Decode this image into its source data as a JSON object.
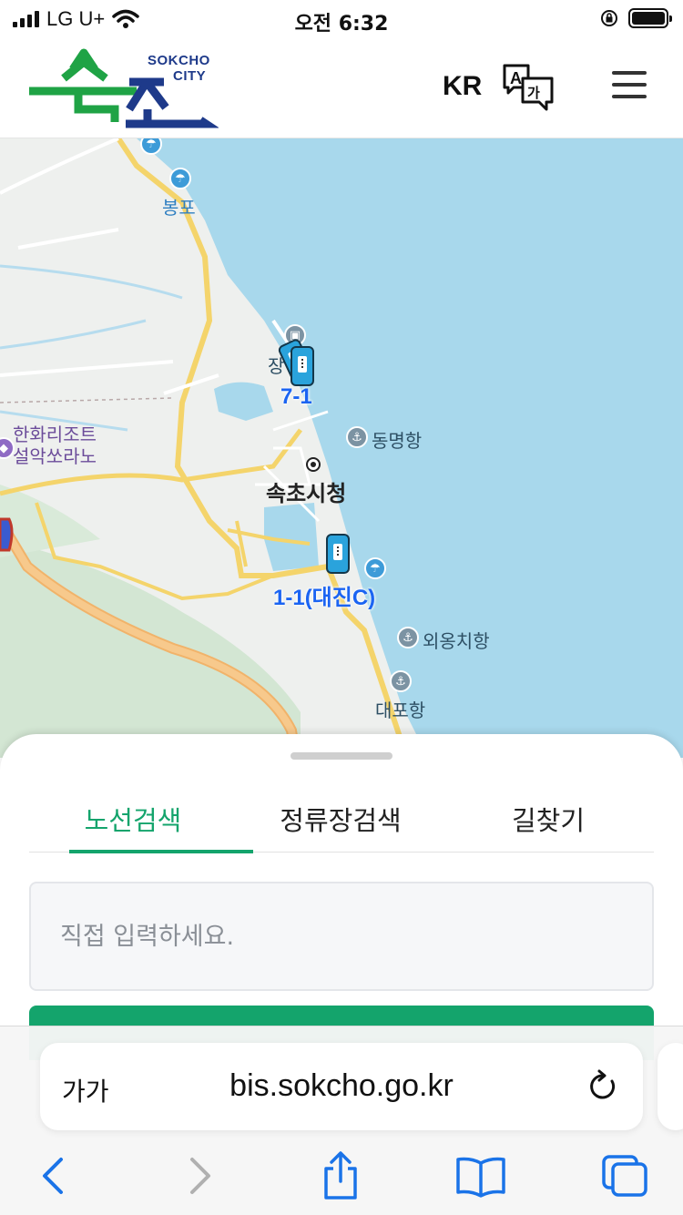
{
  "status_bar": {
    "carrier": "LG U+",
    "time": "오전 6:32"
  },
  "header": {
    "logo_text_en_1": "SOKCHO",
    "logo_text_en_2": "CITY",
    "logo_text_ko": "속초",
    "language": "KR",
    "translate_icon": "translate-icon",
    "menu_icon": "hamburger-menu-icon"
  },
  "map": {
    "labels": {
      "bongpo": "봉포",
      "resort_line1": "한화리조트",
      "resort_line2": "설악쏘라노",
      "city_hall": "속초시청",
      "dongmyeong": "동명항",
      "oeongchi": "외옹치항",
      "daepo": "대포항",
      "jang": "장",
      "route_7_1": "7-1",
      "route_1_1": "1-1(대진C)"
    },
    "colors": {
      "sea": "#a8d8ec",
      "land": "#eef0ee",
      "road_major": "#f4d46b",
      "expressway": "#f1b36a",
      "forest": "#cfe3cf",
      "route_label": "#1b64f2"
    }
  },
  "sheet": {
    "tabs": [
      {
        "label": "노선검색",
        "active": true
      },
      {
        "label": "정류장검색",
        "active": false
      },
      {
        "label": "길찾기",
        "active": false
      }
    ],
    "search_placeholder": "직접 입력하세요.",
    "accent": "#14a46c"
  },
  "browser": {
    "aa_label": "가가",
    "url": "bis.sokcho.go.kr",
    "toolbar_icons": [
      "back-icon",
      "forward-icon",
      "share-icon",
      "bookmarks-icon",
      "tabs-icon"
    ]
  }
}
